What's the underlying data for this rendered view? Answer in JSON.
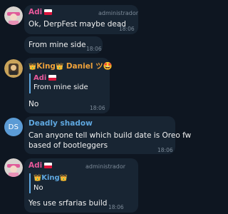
{
  "colors": {
    "background": "#0e1621",
    "bubble": "#182533",
    "name_pink": "#e7589a",
    "name_gold": "#f1a33b",
    "name_blue": "#5fa8e0",
    "time_gray": "#7d8b99"
  },
  "messages": [
    {
      "sender": "Adi",
      "role": "administrador",
      "text": "Ok, DerpFest maybe dead",
      "time": "18:06"
    },
    {
      "text": "From mine side",
      "time": "18:06"
    },
    {
      "sender_prefix": "King",
      "sender_suffix": "Daniel",
      "sender_emoji": "ツ🤩",
      "reply": {
        "name": "Adi",
        "text": "From mine side"
      },
      "text": "No",
      "time": "18:06"
    },
    {
      "avatar_initials": "DS",
      "sender": "Deadly shadow",
      "text_lines": [
        "Can anyone tell which build date is Oreo fw",
        "based of bootleggers"
      ],
      "time": "18:06"
    },
    {
      "sender": "Adi",
      "role": "administrador",
      "reply": {
        "name": "King",
        "text": "No"
      },
      "text": "Yes use srfarias build",
      "time": "18:06"
    }
  ]
}
